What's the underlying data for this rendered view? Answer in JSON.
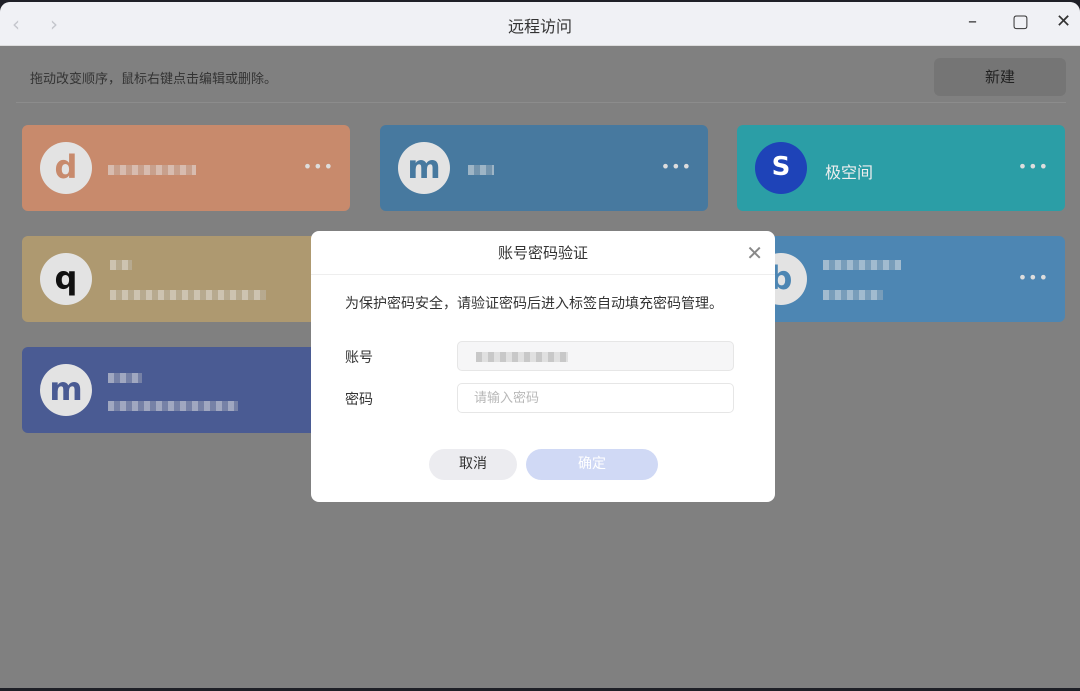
{
  "window": {
    "title": "远程访问"
  },
  "toolbar": {
    "hint": "拖动改变顺序，鼠标右键点击编辑或删除。",
    "new_label": "新建"
  },
  "cards": [
    {
      "letter": "d",
      "color": "#c88a6c",
      "letter_color": "#c88a6c"
    },
    {
      "letter": "m",
      "color": "#47799f",
      "letter_color": "#47799f"
    },
    {
      "name": "极空间",
      "color": "#2b9ea6"
    },
    {
      "letter": "q",
      "color": "#ae9970",
      "letter_color": "#111111"
    },
    {
      "letter": "b",
      "color": "#4d86b3",
      "letter_color": "#4d86b3"
    },
    {
      "letter": "m",
      "color": "#4a5b93",
      "letter_color": "#4a5b93"
    }
  ],
  "dialog": {
    "title": "账号密码验证",
    "description": "为保护密码安全，请验证密码后进入标签自动填充密码管理。",
    "account_label": "账号",
    "password_label": "密码",
    "password_placeholder": "请输入密码",
    "cancel_label": "取消",
    "confirm_label": "确定"
  },
  "icons": {
    "more": "more-icon",
    "close": "close-icon"
  }
}
